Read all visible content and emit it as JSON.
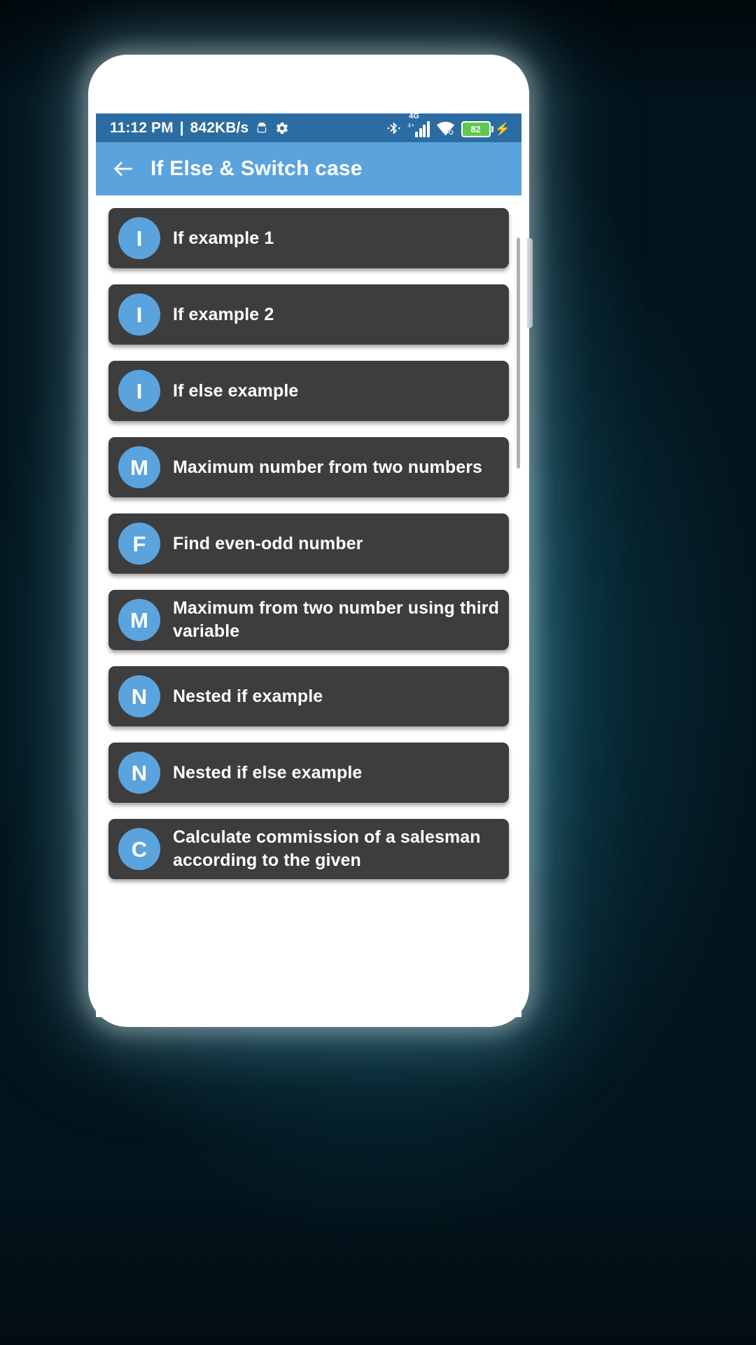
{
  "status_bar": {
    "time": "11:12 PM",
    "separator": "|",
    "network_speed": "842KB/s",
    "icons": [
      "android-head-icon",
      "gear-icon",
      "bluetooth-icon",
      "signal-icon",
      "wifi-icon",
      "battery-icon"
    ],
    "network_type": "4G",
    "network_sub": "4+",
    "signal_bars": 4,
    "battery_level": "82",
    "charging": true,
    "background_color": "#2b6ca3"
  },
  "app_bar": {
    "back_label": "back-arrow",
    "title": "If Else & Switch case",
    "background_color": "#5ba3dd"
  },
  "theme": {
    "accent": "#5ba3dd",
    "card": "#3d3d3d",
    "page": "#ffffff",
    "battery_green": "#5ec94a"
  },
  "list": {
    "items": [
      {
        "initial": "I",
        "label": "If example 1"
      },
      {
        "initial": "I",
        "label": "If example 2"
      },
      {
        "initial": "I",
        "label": "If else example"
      },
      {
        "initial": "M",
        "label": "Maximum number from two numbers"
      },
      {
        "initial": "F",
        "label": "Find even-odd number"
      },
      {
        "initial": "M",
        "label": "Maximum from two number using third variable"
      },
      {
        "initial": "N",
        "label": "Nested if example"
      },
      {
        "initial": "N",
        "label": "Nested if else example"
      },
      {
        "initial": "C",
        "label": "Calculate commission of a salesman according to the given"
      }
    ]
  }
}
